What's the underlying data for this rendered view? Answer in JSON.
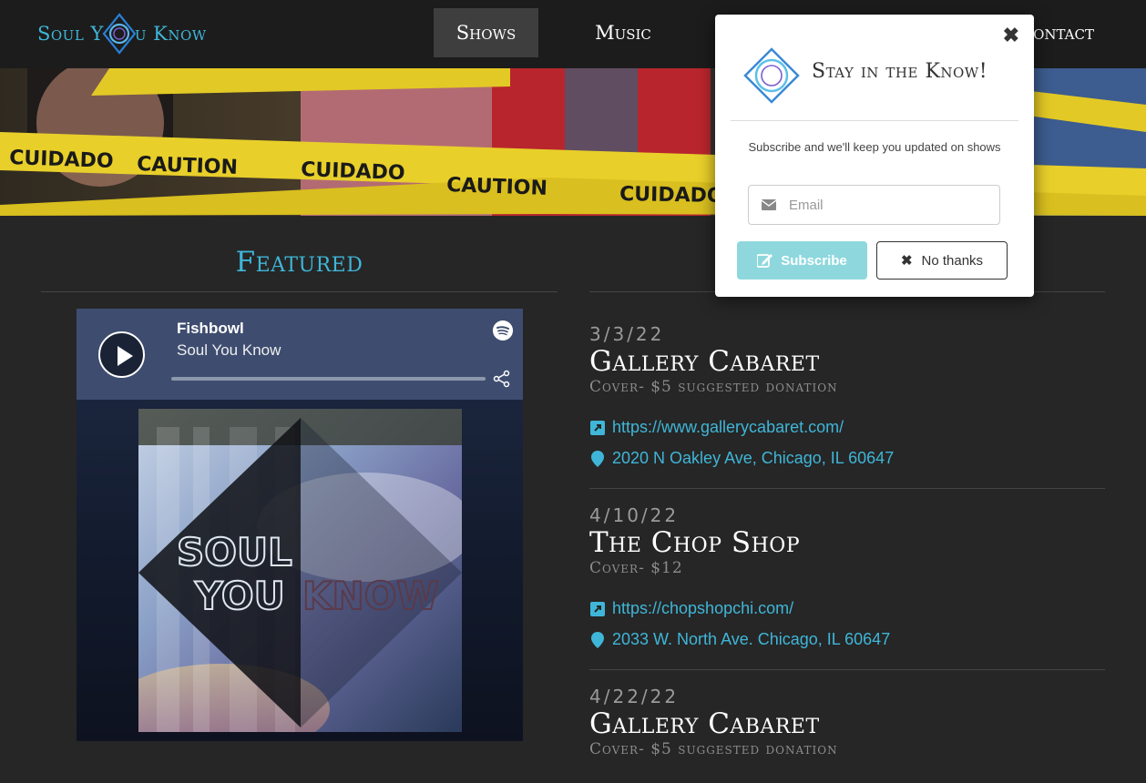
{
  "brand": {
    "name_left": "Soul Y",
    "name_right": "u Know",
    "accent": "#3fb6d8"
  },
  "nav": {
    "shows": "Shows",
    "music": "Music",
    "contact": "Contact"
  },
  "featured": {
    "title": "Featured"
  },
  "player": {
    "track": "Fishbowl",
    "artist": "Soul You Know",
    "play_icon": "play-icon",
    "service_icon": "spotify-icon",
    "share_icon": "share-icon"
  },
  "cover_art": {
    "line1": "SOUL",
    "line2a": "YOU",
    "line2b": "KNOW"
  },
  "shows": [
    {
      "date": "3/3/22",
      "venue": "Gallery Cabaret",
      "cover": "Cover- $5 suggested donation",
      "url": "https://www.gallerycabaret.com/",
      "address": "2020 N Oakley Ave, Chicago, IL 60647"
    },
    {
      "date": "4/10/22",
      "venue": "The Chop Shop",
      "cover": "Cover- $12",
      "url": "https://chopshopchi.com/",
      "address": "2033 W. North Ave. Chicago, IL 60647"
    },
    {
      "date": "4/22/22",
      "venue": "Gallery Cabaret",
      "cover": "Cover- $5 suggested donation"
    }
  ],
  "banner": {
    "tape_words": [
      "CUIDADO",
      "CAUTION",
      "CUIDADO",
      "CAUTION",
      "CUIDADO"
    ]
  },
  "modal": {
    "heading": "Stay in the Know!",
    "text": "Subscribe and we'll keep you updated on shows",
    "email_placeholder": "Email",
    "subscribe_label": "Subscribe",
    "nothanks_label": "No thanks",
    "close_glyph": "✖",
    "subscribe_color": "#8ed8dd"
  }
}
